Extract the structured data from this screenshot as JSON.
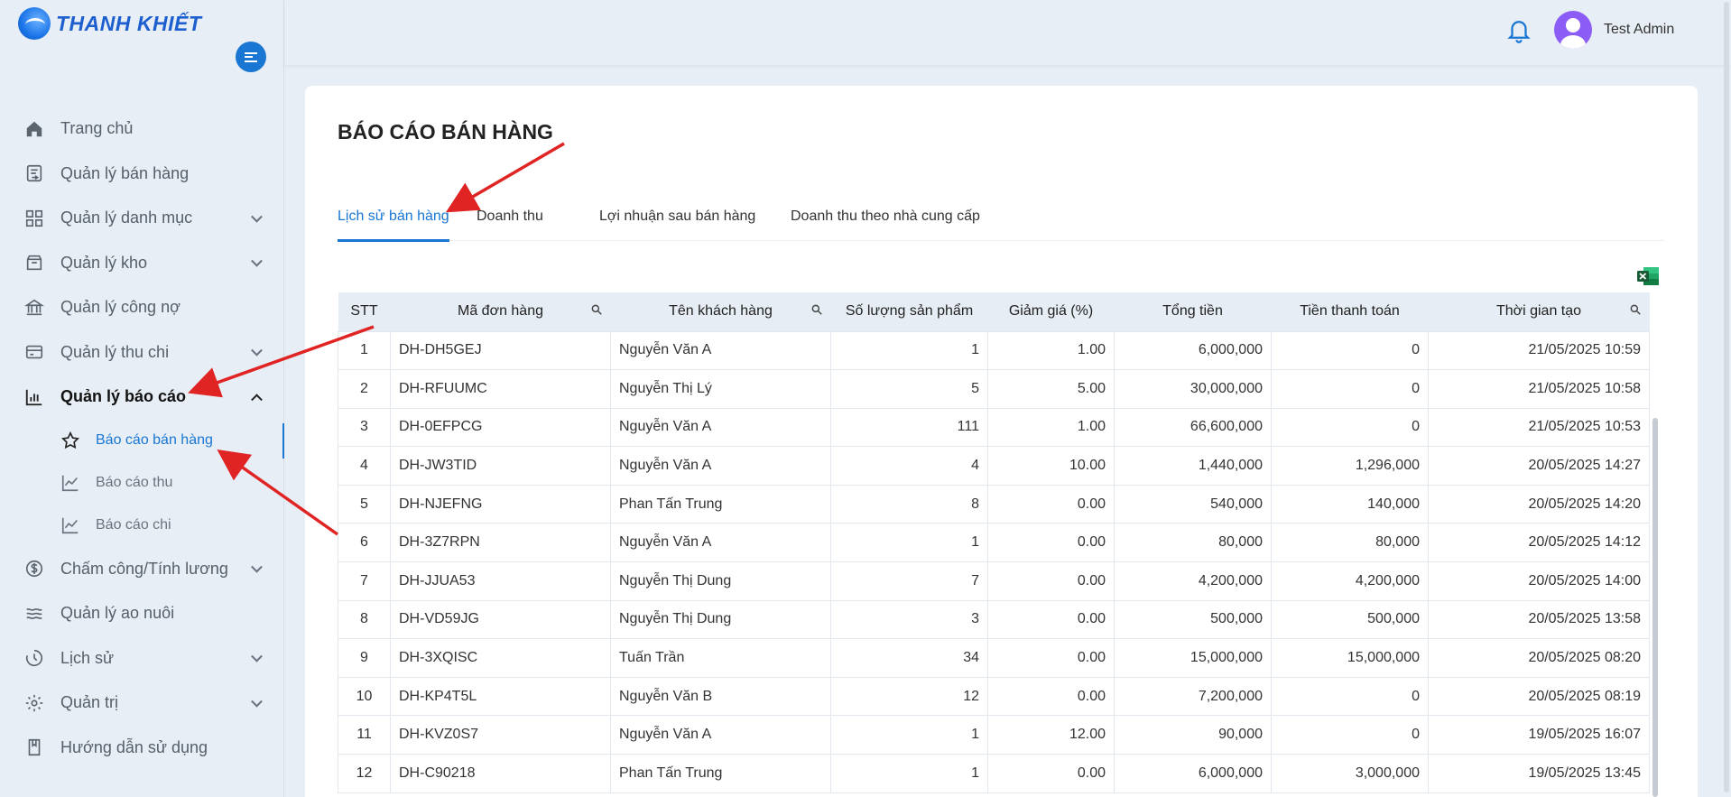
{
  "brand": {
    "name": "THANH KHIẾT"
  },
  "header": {
    "user_name": "Test Admin"
  },
  "sidebar": {
    "items": [
      {
        "label": "Trang chủ",
        "icon": "home-icon",
        "chevron": ""
      },
      {
        "label": "Quản lý bán hàng",
        "icon": "sales-icon",
        "chevron": ""
      },
      {
        "label": "Quản lý danh mục",
        "icon": "grid-icon",
        "chevron": "down"
      },
      {
        "label": "Quản lý kho",
        "icon": "warehouse-icon",
        "chevron": "down"
      },
      {
        "label": "Quản lý công nợ",
        "icon": "bank-icon",
        "chevron": ""
      },
      {
        "label": "Quản lý thu chi",
        "icon": "wallet-icon",
        "chevron": "down"
      },
      {
        "label": "Quản lý báo cáo",
        "icon": "bar-chart-icon",
        "chevron": "up",
        "active": true
      }
    ],
    "subitems": [
      {
        "label": "Báo cáo bán hàng",
        "icon": "star-icon",
        "active": true
      },
      {
        "label": "Báo cáo thu",
        "icon": "line-chart-icon"
      },
      {
        "label": "Báo cáo chi",
        "icon": "line-chart-icon"
      }
    ],
    "items_after": [
      {
        "label": "Chấm công/Tính lương",
        "icon": "dollar-circle-icon",
        "chevron": "down"
      },
      {
        "label": "Quản lý ao nuôi",
        "icon": "waves-icon",
        "chevron": ""
      },
      {
        "label": "Lịch sử",
        "icon": "history-icon",
        "chevron": "down"
      },
      {
        "label": "Quản trị",
        "icon": "settings-icon",
        "chevron": "down"
      },
      {
        "label": "Hướng dẫn sử dụng",
        "icon": "book-icon",
        "chevron": ""
      }
    ]
  },
  "main": {
    "title": "BÁO CÁO BÁN HÀNG",
    "tabs": [
      {
        "label": "Lịch sử bán hàng",
        "active": true
      },
      {
        "label": "Doanh thu"
      },
      {
        "label": "Lợi nhuận sau bán hàng"
      },
      {
        "label": "Doanh thu theo nhà cung cấp"
      }
    ],
    "export_icon": "excel-icon",
    "table": {
      "columns": [
        "STT",
        "Mã đơn hàng",
        "Tên khách hàng",
        "Số lượng sản phẩm",
        "Giảm giá (%)",
        "Tổng tiền",
        "Tiền thanh toán",
        "Thời gian tạo"
      ],
      "rows": [
        [
          "1",
          "DH-DH5GEJ",
          "Nguyễn Văn A",
          "1",
          "1.00",
          "6,000,000",
          "0",
          "21/05/2025 10:59"
        ],
        [
          "2",
          "DH-RFUUMC",
          "Nguyễn Thị Lý",
          "5",
          "5.00",
          "30,000,000",
          "0",
          "21/05/2025 10:58"
        ],
        [
          "3",
          "DH-0EFPCG",
          "Nguyễn Văn A",
          "111",
          "1.00",
          "66,600,000",
          "0",
          "21/05/2025 10:53"
        ],
        [
          "4",
          "DH-JW3TID",
          "Nguyễn Văn A",
          "4",
          "10.00",
          "1,440,000",
          "1,296,000",
          "20/05/2025 14:27"
        ],
        [
          "5",
          "DH-NJEFNG",
          "Phan Tấn Trung",
          "8",
          "0.00",
          "540,000",
          "140,000",
          "20/05/2025 14:20"
        ],
        [
          "6",
          "DH-3Z7RPN",
          "Nguyễn Văn A",
          "1",
          "0.00",
          "80,000",
          "80,000",
          "20/05/2025 14:12"
        ],
        [
          "7",
          "DH-JJUA53",
          "Nguyễn Thị Dung",
          "7",
          "0.00",
          "4,200,000",
          "4,200,000",
          "20/05/2025 14:00"
        ],
        [
          "8",
          "DH-VD59JG",
          "Nguyễn Thị Dung",
          "3",
          "0.00",
          "500,000",
          "500,000",
          "20/05/2025 13:58"
        ],
        [
          "9",
          "DH-3XQISC",
          "Tuấn Trần",
          "34",
          "0.00",
          "15,000,000",
          "15,000,000",
          "20/05/2025 08:20"
        ],
        [
          "10",
          "DH-KP4T5L",
          "Nguyễn Văn B",
          "12",
          "0.00",
          "7,200,000",
          "0",
          "20/05/2025 08:19"
        ],
        [
          "11",
          "DH-KVZ0S7",
          "Nguyễn Văn A",
          "1",
          "12.00",
          "90,000",
          "0",
          "19/05/2025 16:07"
        ],
        [
          "12",
          "DH-C90218",
          "Phan Tấn Trung",
          "1",
          "0.00",
          "6,000,000",
          "3,000,000",
          "19/05/2025 13:45"
        ]
      ]
    }
  },
  "colors": {
    "accent": "#1976d2",
    "annotation": "#e02424",
    "avatar": "#8b5cf6"
  }
}
